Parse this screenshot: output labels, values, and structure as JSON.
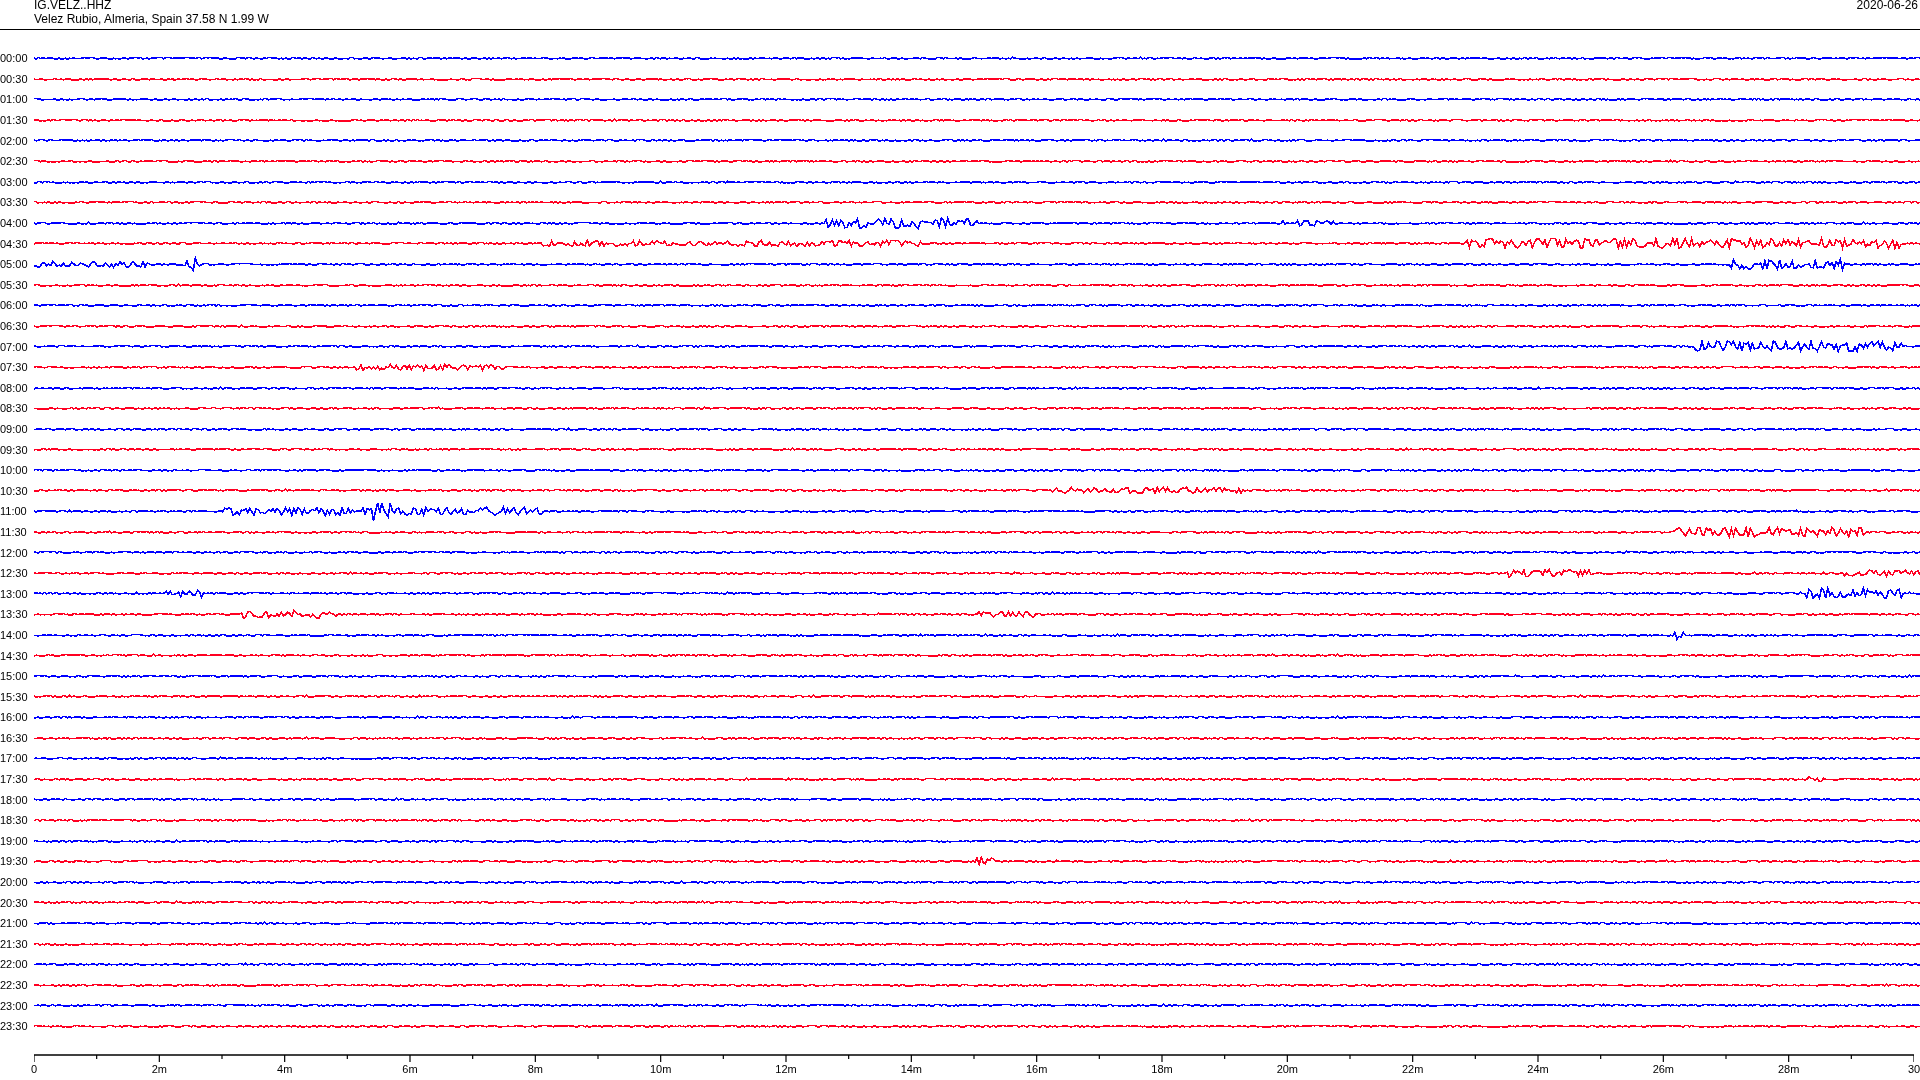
{
  "header": {
    "station": "IG.VELZ..HHZ",
    "location": "Velez Rubio, Almeria, Spain  37.58 N 1.99 W",
    "date": "2020-06-26"
  },
  "traces": [
    {
      "time": "00:00",
      "color": "#0000ff"
    },
    {
      "time": "00:30",
      "color": "#ff0022"
    },
    {
      "time": "01:00",
      "color": "#0000ff"
    },
    {
      "time": "01:30",
      "color": "#ff0022"
    },
    {
      "time": "02:00",
      "color": "#0000ff"
    },
    {
      "time": "02:30",
      "color": "#ff0022"
    },
    {
      "time": "03:00",
      "color": "#0000ff"
    },
    {
      "time": "03:30",
      "color": "#ff0022"
    },
    {
      "time": "04:00",
      "color": "#0000ff"
    },
    {
      "time": "04:30",
      "color": "#ff0022"
    },
    {
      "time": "05:00",
      "color": "#0000ff"
    },
    {
      "time": "05:30",
      "color": "#ff0022"
    },
    {
      "time": "06:00",
      "color": "#0000ff"
    },
    {
      "time": "06:30",
      "color": "#ff0022"
    },
    {
      "time": "07:00",
      "color": "#0000ff"
    },
    {
      "time": "07:30",
      "color": "#ff0022"
    },
    {
      "time": "08:00",
      "color": "#0000ff"
    },
    {
      "time": "08:30",
      "color": "#ff0022"
    },
    {
      "time": "09:00",
      "color": "#0000ff"
    },
    {
      "time": "09:30",
      "color": "#ff0022"
    },
    {
      "time": "10:00",
      "color": "#0000ff"
    },
    {
      "time": "10:30",
      "color": "#ff0022"
    },
    {
      "time": "11:00",
      "color": "#0000ff"
    },
    {
      "time": "11:30",
      "color": "#ff0022"
    },
    {
      "time": "12:00",
      "color": "#0000ff"
    },
    {
      "time": "12:30",
      "color": "#ff0022"
    },
    {
      "time": "13:00",
      "color": "#0000ff"
    },
    {
      "time": "13:30",
      "color": "#ff0022"
    },
    {
      "time": "14:00",
      "color": "#0000ff"
    },
    {
      "time": "14:30",
      "color": "#ff0022"
    },
    {
      "time": "15:00",
      "color": "#0000ff"
    },
    {
      "time": "15:30",
      "color": "#ff0022"
    },
    {
      "time": "16:00",
      "color": "#0000ff"
    },
    {
      "time": "16:30",
      "color": "#ff0022"
    },
    {
      "time": "17:00",
      "color": "#0000ff"
    },
    {
      "time": "17:30",
      "color": "#ff0022"
    },
    {
      "time": "18:00",
      "color": "#0000ff"
    },
    {
      "time": "18:30",
      "color": "#ff0022"
    },
    {
      "time": "19:00",
      "color": "#0000ff"
    },
    {
      "time": "19:30",
      "color": "#ff0022"
    },
    {
      "time": "20:00",
      "color": "#0000ff"
    },
    {
      "time": "20:30",
      "color": "#ff0022"
    },
    {
      "time": "21:00",
      "color": "#0000ff"
    },
    {
      "time": "21:30",
      "color": "#ff0022"
    },
    {
      "time": "22:00",
      "color": "#0000ff"
    },
    {
      "time": "22:30",
      "color": "#ff0022"
    },
    {
      "time": "23:00",
      "color": "#0000ff"
    },
    {
      "time": "23:30",
      "color": "#ff0022"
    }
  ],
  "time_axis": {
    "labels": [
      "0",
      "2m",
      "4m",
      "6m",
      "8m",
      "10m",
      "12m",
      "14m",
      "16m",
      "18m",
      "20m",
      "22m",
      "24m",
      "26m",
      "28m",
      "30"
    ]
  }
}
